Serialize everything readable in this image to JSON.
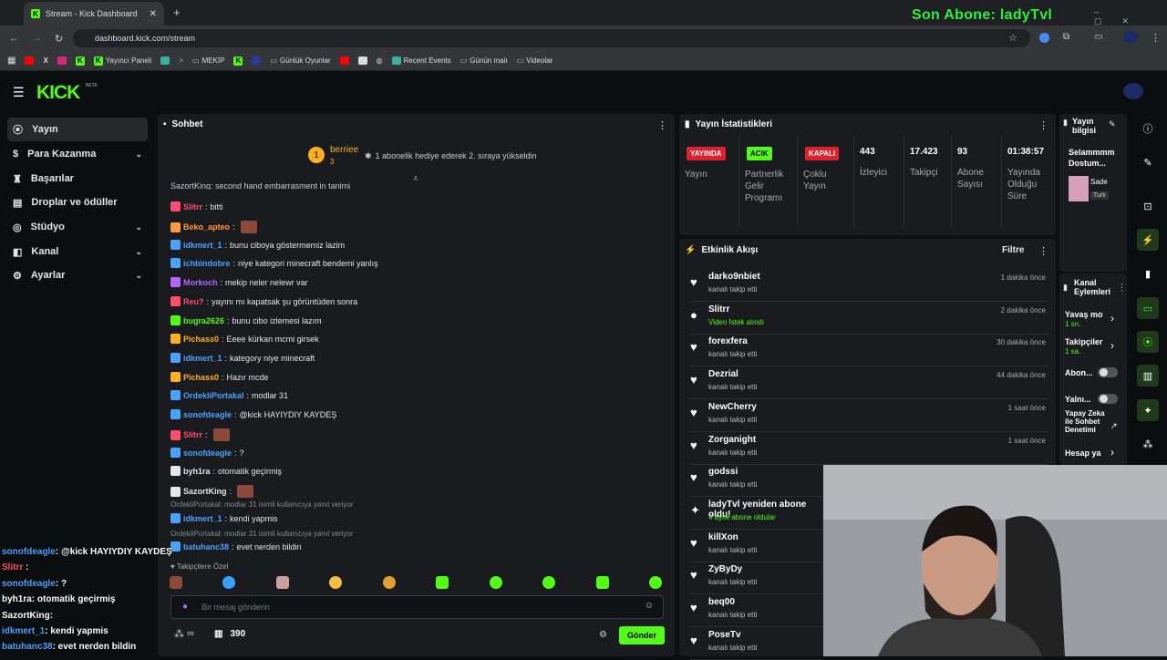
{
  "browser": {
    "tab_title": "Stream - Kick Dashboard",
    "url": "dashboard.kick.com/stream",
    "overlay_sub": "Son Abone: ladyTvl",
    "bookmarks": [
      "Yayıncı Paneli",
      "MEKİP",
      "Günlük Oyunlar",
      "Recent Events",
      "Günün malı",
      "Videolar"
    ]
  },
  "nav": {
    "logo": "KICK",
    "beta": "BETA"
  },
  "sidebar": {
    "items": [
      {
        "label": "Yayın",
        "icon": "broadcast-icon"
      },
      {
        "label": "Para Kazanma",
        "icon": "dollar-icon"
      },
      {
        "label": "Başarılar",
        "icon": "trophy-icon"
      },
      {
        "label": "Droplar ve ödüller",
        "icon": "gift-icon"
      },
      {
        "label": "Stüdyo",
        "icon": "studio-icon"
      },
      {
        "label": "Kanal",
        "icon": "channel-icon"
      },
      {
        "label": "Ayarlar",
        "icon": "gear-icon"
      }
    ]
  },
  "chat": {
    "title": "Sohbet",
    "pinned_user": "berriee",
    "pinned_count": "3",
    "pinned_text": "1 abonelik hediye ederek 2. sıraya yükseldin",
    "partial_line": "SazortKing: second hand embarrasment in tanimi",
    "messages": [
      {
        "user": "Slitrr",
        "text": "bitti",
        "color": "#ff4d6d"
      },
      {
        "user": "Beko_apteo",
        "text": "",
        "color": "#ff9a3c"
      },
      {
        "user": "idkmert_1",
        "text": "bunu ciboya göstermemiz lazim",
        "color": "#4aa3ff"
      },
      {
        "user": "ichbindobre",
        "text": "niye kategori minecraft bendemi yanlış",
        "color": "#4aa3ff"
      },
      {
        "user": "Morkoch",
        "text": "mekip neler nelewr var",
        "color": "#b266ff"
      },
      {
        "user": "Reu?",
        "text": "yayını mı kapatsak şu görüntüden sonra",
        "color": "#ff4d6d"
      },
      {
        "user": "bugra2626",
        "text": "bunu cibo izlemesi lazım",
        "color": "#53fc18"
      },
      {
        "user": "Pichass0",
        "text": "Eeee kürkan mcmi girsek",
        "color": "#ffb020"
      },
      {
        "user": "idkmert_1",
        "text": "kategory niye minecraft",
        "color": "#4aa3ff"
      },
      {
        "user": "Pichass0",
        "text": "Hazır mcde",
        "color": "#ffb020"
      },
      {
        "user": "OrdekliPortakal",
        "text": "modlar 31",
        "color": "#4aa3ff"
      },
      {
        "user": "sonofdeagle",
        "text": "@kick HAYIYDIY KAYDEŞ",
        "color": "#4aa3ff"
      },
      {
        "user": "Slitrr",
        "text": "",
        "color": "#ff4d6d"
      },
      {
        "user": "sonofdeagle",
        "text": "?",
        "color": "#4aa3ff"
      },
      {
        "user": "byh1ra",
        "text": "otomatik geçirmiş",
        "color": "#e6e6e6"
      },
      {
        "user": "SazortKing",
        "text": "",
        "color": "#e6e6e6"
      },
      {
        "user": "idkmert_1",
        "text": "kendi yapmis",
        "color": "#4aa3ff"
      },
      {
        "user": "batuhanc38",
        "text": "evet nerden bildin",
        "color": "#4aa3ff"
      }
    ],
    "reply1": "OrdekliPortakal: modlar 31 isimli kullanıcıya yanıt veriyor",
    "reply2": "OrdekliPortakal: modlar 31 isimli kullanıcıya yanıt veriyor",
    "followers_only": "Takipçilere Özel",
    "input_placeholder": "Bir mesaj gönderin",
    "infinity": "∞",
    "points": "390",
    "send": "Gönder"
  },
  "stats": {
    "title": "Yayın İstatistikleri",
    "cols": [
      {
        "pill": "YAYINDA",
        "label": "Yayın"
      },
      {
        "pill": "ACIK",
        "label": "Partnerlik Gelir Programı"
      },
      {
        "pill": "KAPALI",
        "label": "Çoklu Yayın"
      },
      {
        "value": "443",
        "label": "İzleyici"
      },
      {
        "value": "17.423",
        "label": "Takipçi"
      },
      {
        "value": "93",
        "label": "Abone Sayısı"
      },
      {
        "value": "01:38:57",
        "label": "Yayında Olduğu Süre"
      }
    ]
  },
  "feed": {
    "title": "Etkinlik Akışı",
    "filter": "Filtre",
    "items": [
      {
        "name": "darko9nbiet",
        "sub": "kanalı takip etti",
        "time": "1 dakika önce",
        "icon": "♥"
      },
      {
        "name": "Slitrr",
        "sub": "Video İstek alındı",
        "time": "2 dakika önce",
        "icon": "●"
      },
      {
        "name": "forexfera",
        "sub": "kanalı takip etti",
        "time": "30 dakika önce",
        "icon": "♥"
      },
      {
        "name": "Dezrial",
        "sub": "kanalı takip etti",
        "time": "44 dakika önce",
        "icon": "♥"
      },
      {
        "name": "NewCherry",
        "sub": "kanalı takip etti",
        "time": "1 saat önce",
        "icon": "♥"
      },
      {
        "name": "Zorganight",
        "sub": "kanalı takip etti",
        "time": "1 saat önce",
        "icon": "♥"
      },
      {
        "name": "godssi",
        "sub": "kanalı takip etti",
        "time": "",
        "icon": "♥"
      },
      {
        "name": "ladyTvl yeniden abone oldu!",
        "sub": "4 aylık abone oldular",
        "time": "",
        "icon": "✦"
      },
      {
        "name": "killXon",
        "sub": "kanalı takip etti",
        "time": "",
        "icon": "♥"
      },
      {
        "name": "ZyByDy",
        "sub": "kanalı takip etti",
        "time": "",
        "icon": "♥"
      },
      {
        "name": "beq00",
        "sub": "kanalı takip etti",
        "time": "",
        "icon": "♥"
      },
      {
        "name": "PoseTv",
        "sub": "kanalı takip etti",
        "time": "",
        "icon": "♥"
      }
    ]
  },
  "info": {
    "title": "Yayın bilgisi",
    "stream_title": "Selammmm Dostum...",
    "cat1": "Sade",
    "cat2": "Turk"
  },
  "actions": {
    "title": "Kanal Eylemleri",
    "rows": [
      {
        "label": "Yavaş mo",
        "sub": "1 sn."
      },
      {
        "label": "Takipçiler",
        "sub": "1 sa."
      },
      {
        "label": "Abon..."
      },
      {
        "label": "Yalnı..."
      },
      {
        "label": "Yapay Zeka ile Sohbet Denetimi"
      },
      {
        "label": "Hesap ya"
      }
    ]
  },
  "overlay_chat": [
    {
      "user": "sonofdeagle",
      "text": ": @kick HAYIYDIY KAYDEŞ",
      "color": "#4aa3ff"
    },
    {
      "user": "Slitrr",
      "text": " :",
      "color": "#ff4d6d"
    },
    {
      "user": "sonofdeagle",
      "text": ": ?",
      "color": "#4aa3ff"
    },
    {
      "user": "byh1ra",
      "text": ": otomatik geçirmiş",
      "color": "#ffffff"
    },
    {
      "user": "SazortKing",
      "text": ":",
      "color": "#ffffff"
    },
    {
      "user": "idkmert_1",
      "text": ": kendi yapmis",
      "color": "#4aa3ff"
    },
    {
      "user": "batuhanc38",
      "text": ": evet nerden bildin",
      "color": "#4aa3ff"
    }
  ],
  "colors": {
    "brand": "#53fc18",
    "panel": "#191b1f",
    "bg": "#0b0e0f",
    "live": "#e0202a"
  }
}
